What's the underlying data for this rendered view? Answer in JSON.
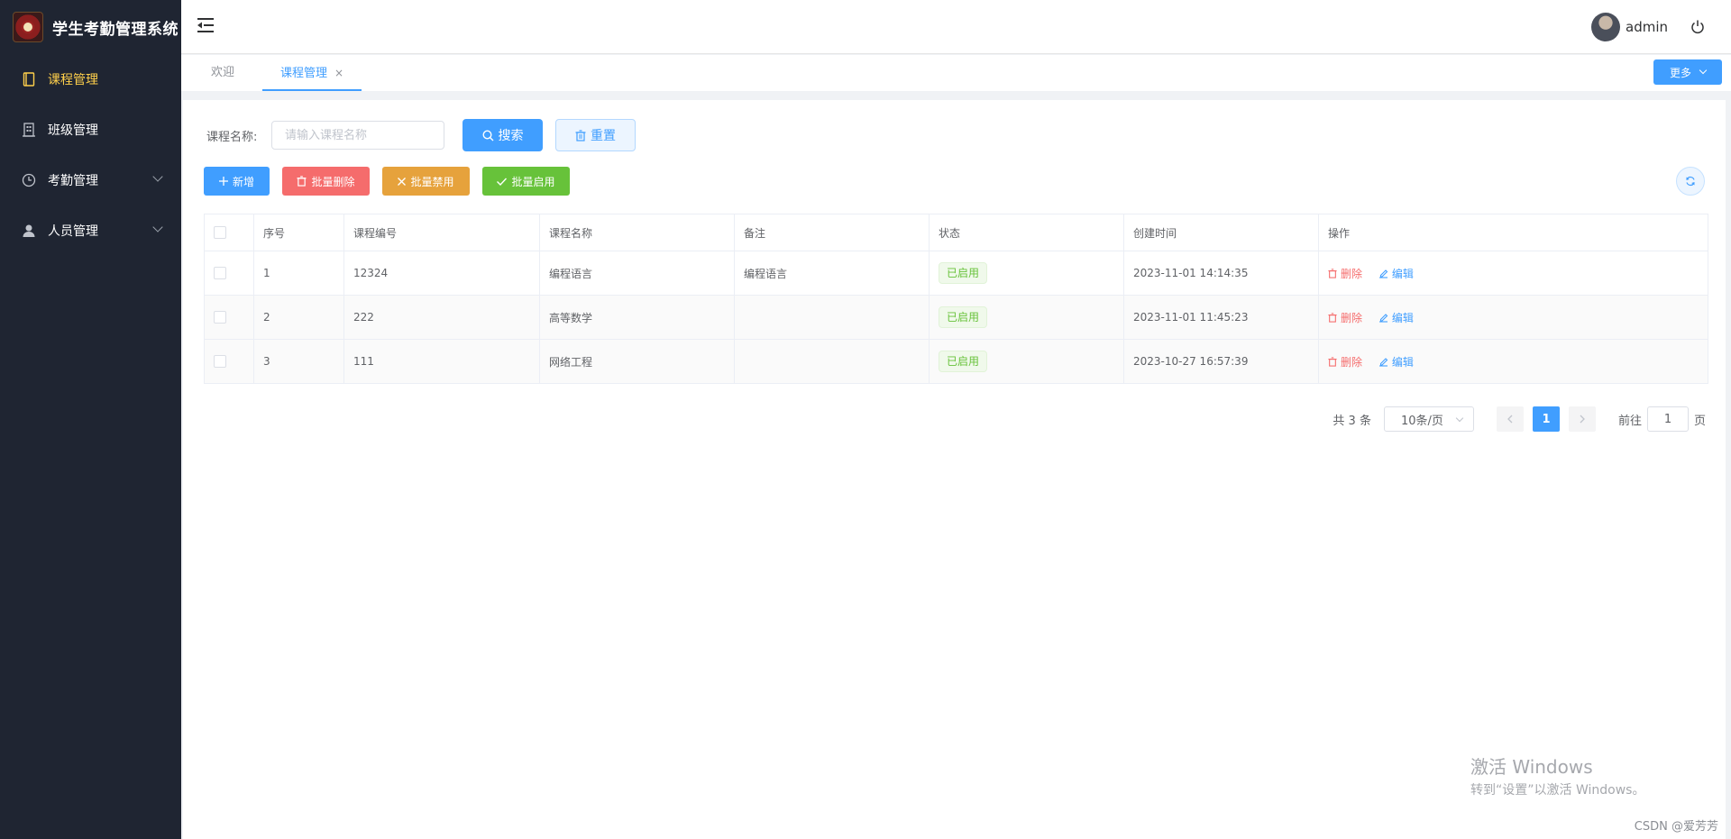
{
  "app": {
    "title": "学生考勤管理系统"
  },
  "sidebar": {
    "items": [
      {
        "label": "课程管理",
        "icon": "book-icon",
        "active": true
      },
      {
        "label": "班级管理",
        "icon": "building-icon",
        "active": false
      },
      {
        "label": "考勤管理",
        "icon": "clock-icon",
        "active": false,
        "expandable": true
      },
      {
        "label": "人员管理",
        "icon": "user-icon",
        "active": false,
        "expandable": true
      }
    ]
  },
  "header": {
    "username": "admin"
  },
  "tabs": [
    {
      "label": "欢迎",
      "active": false
    },
    {
      "label": "课程管理",
      "active": true,
      "closable": true,
      "close": "×"
    }
  ],
  "more_button": "更多",
  "search": {
    "label": "课程名称:",
    "placeholder": "请输入课程名称",
    "value": "",
    "search_button": "搜索",
    "reset_button": "重置"
  },
  "toolbar": {
    "add": "新增",
    "batch_delete": "批量删除",
    "batch_disable": "批量禁用",
    "batch_enable": "批量启用"
  },
  "table": {
    "columns": [
      "序号",
      "课程编号",
      "课程名称",
      "备注",
      "状态",
      "创建时间",
      "操作"
    ],
    "rows": [
      {
        "index": "1",
        "code": "12324",
        "name": "编程语言",
        "remark": "编程语言",
        "status": "已启用",
        "created": "2023-11-01 14:14:35"
      },
      {
        "index": "2",
        "code": "222",
        "name": "高等数学",
        "remark": "",
        "status": "已启用",
        "created": "2023-11-01 11:45:23"
      },
      {
        "index": "3",
        "code": "111",
        "name": "网络工程",
        "remark": "",
        "status": "已启用",
        "created": "2023-10-27 16:57:39"
      }
    ],
    "actions": {
      "delete": "删除",
      "edit": "编辑"
    }
  },
  "pagination": {
    "total_text": "共 3 条",
    "page_size": "10条/页",
    "current_page": "1",
    "goto_prefix": "前往",
    "goto_value": "1",
    "goto_suffix": "页"
  },
  "watermark": {
    "windows_line1": "激活 Windows",
    "windows_line2": "转到“设置”以激活 Windows。",
    "csdn": "CSDN @爱芳芳"
  },
  "colors": {
    "sidebar_bg": "#1f2532",
    "active_menu": "#ffd04b",
    "primary": "#409eff",
    "danger": "#f56c6c",
    "warning": "#e6a23c",
    "success": "#67c23a"
  }
}
